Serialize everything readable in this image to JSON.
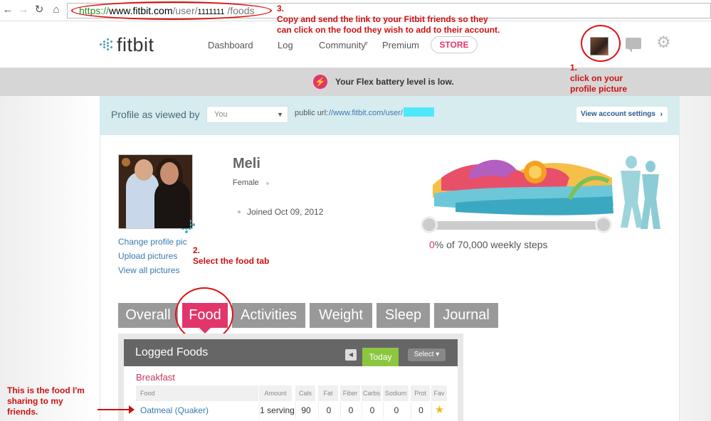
{
  "browser": {
    "back_icon": "back-arrow-icon",
    "forward_icon": "forward-arrow-icon",
    "reload_icon": "reload-icon",
    "home_icon": "home-icon",
    "url_scheme": "https://",
    "url_host": "www.fitbit.com",
    "url_path_start": "/user/",
    "url_user_id": "1111111",
    "url_path_end": " /foods"
  },
  "header": {
    "logo_text": "fitbit",
    "nav": [
      "Dashboard",
      "Log",
      "Community",
      "Premium"
    ],
    "community_caret": "▾",
    "store_label": "STORE",
    "icons": [
      "avatar",
      "chat-icon",
      "gear-icon"
    ]
  },
  "battery_banner": {
    "icon": "⚡",
    "text": "Your Flex battery level is low."
  },
  "annotations": {
    "step1": [
      "1.",
      "click on your",
      "profile picture"
    ],
    "step2": [
      "2.",
      "Select the food tab"
    ],
    "step3": [
      "3.",
      "Copy and send the link to your Fitbit friends so they",
      "can click on the food they wish to add to their account."
    ],
    "food_note": [
      "This is the food I'm",
      "sharing to my",
      "friends."
    ]
  },
  "profile_bar": {
    "label": "Profile as viewed by",
    "viewer_value": "You",
    "public_url_label": "public url:",
    "public_url_value": "//www.fitbit.com/user/",
    "settings_label": "View account settings",
    "settings_arrow": "›"
  },
  "profile": {
    "name": "Meli",
    "gender": "Female",
    "joined": "Joined Oct 09, 2012",
    "links": [
      "Change profile pic",
      "Upload pictures",
      "View all pictures"
    ]
  },
  "steps": {
    "value": "0",
    "suffix": "% of 70,000 weekly steps",
    "progress_fraction": 0
  },
  "tabs": {
    "items": [
      "Overall",
      "Food",
      "Activities",
      "Weight",
      "Sleep",
      "Journal"
    ],
    "active": "Food"
  },
  "logged_foods": {
    "title": "Logged Foods",
    "prev_icon": "◀",
    "today_label": "Today",
    "select_label": "Select ▾",
    "meal": "Breakfast",
    "columns": [
      "Food",
      "Amount",
      "Cals",
      "Fat",
      "Fiber",
      "Carbs",
      "Sodium",
      "Prot",
      "Fav"
    ],
    "row": {
      "food": "Oatmeal (Quaker)",
      "amount": "1 serving",
      "cals": "90",
      "fat": "0",
      "fiber": "0",
      "carbs": "0",
      "sodium": "0",
      "prot": "0",
      "fav": "★"
    }
  },
  "colors": {
    "brand_pink": "#e2366b",
    "annotation_red": "#cc1111",
    "today_green": "#8cc63f",
    "profile_bar_bg": "#d6ecef",
    "tab_gray": "#999999"
  }
}
